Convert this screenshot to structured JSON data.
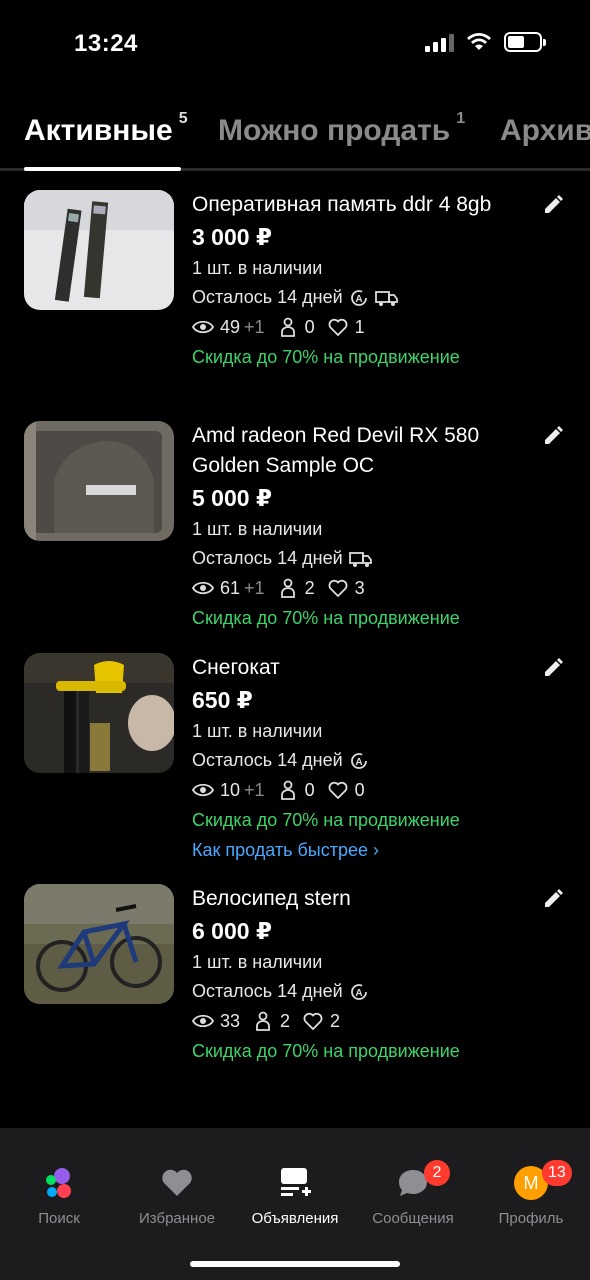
{
  "status_bar": {
    "time": "13:24"
  },
  "tabs": [
    {
      "label": "Активные",
      "count": "5"
    },
    {
      "label": "Можно продать",
      "count": "1"
    },
    {
      "label": "Архив",
      "count": ""
    }
  ],
  "listings": [
    {
      "title": "Оперативная память ddr 4 8gb",
      "price": "3 000 ₽",
      "stock": "1 шт. в наличии",
      "remaining": "Осталось 14 дней",
      "views": "49",
      "views_delta": "+1",
      "contacts": "0",
      "favorites": "1",
      "promo": "Скидка до 70% на продвижение",
      "how_to": ""
    },
    {
      "title": "Amd radeon Red Devil RX 580 Golden Sample OC",
      "price": "5 000 ₽",
      "stock": "1 шт. в наличии",
      "remaining": "Осталось 14 дней",
      "views": "61",
      "views_delta": "+1",
      "contacts": "2",
      "favorites": "3",
      "promo": "Скидка до 70% на продвижение",
      "how_to": ""
    },
    {
      "title": "Снегокат",
      "price": "650 ₽",
      "stock": "1 шт. в наличии",
      "remaining": "Осталось 14 дней",
      "views": "10",
      "views_delta": "+1",
      "contacts": "0",
      "favorites": "0",
      "promo": "Скидка до 70% на продвижение",
      "how_to": "Как продать быстрее"
    },
    {
      "title": "Велосипед stern",
      "price": "6 000 ₽",
      "stock": "1 шт. в наличии",
      "remaining": "Осталось 14 дней",
      "views": "33",
      "views_delta": "",
      "contacts": "2",
      "favorites": "2",
      "promo": "Скидка до 70% на продвижение",
      "how_to": ""
    }
  ],
  "bottom_nav": {
    "search": "Поиск",
    "favorites": "Избранное",
    "ads": "Объявления",
    "messages": "Сообщения",
    "messages_badge": "2",
    "profile": "Профиль",
    "profile_badge": "13",
    "profile_avatar_letter": "M"
  },
  "colors": {
    "promo": "#3dd36b",
    "link": "#4aa8ff",
    "badge": "#ff3b30",
    "avatar": "#ffa000"
  }
}
